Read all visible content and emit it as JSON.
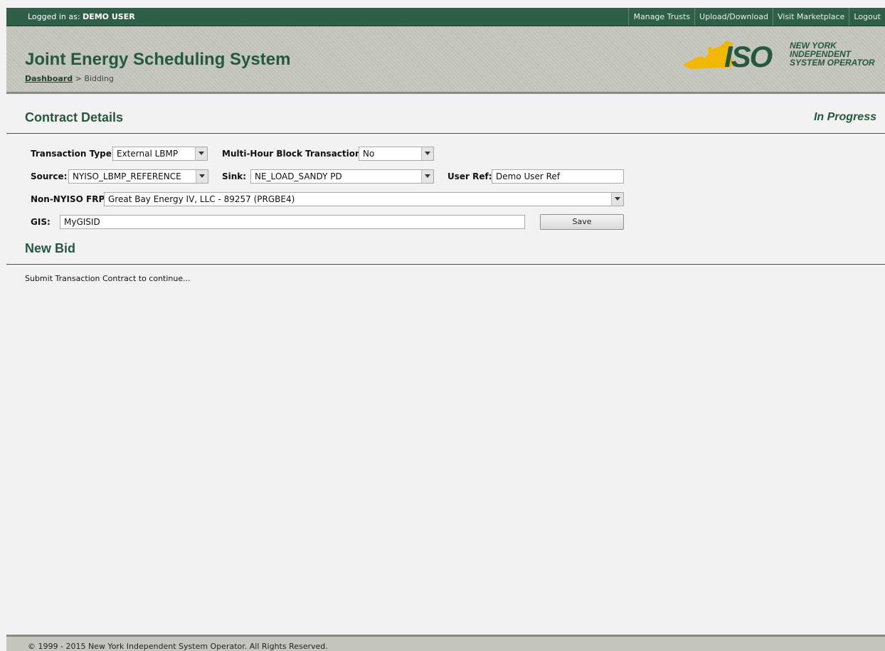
{
  "topbar": {
    "logged_prefix": "Logged in as:",
    "user": "DEMO USER",
    "nav": [
      "Manage Trusts",
      "Upload/Download",
      "Visit Marketplace",
      "Logout"
    ]
  },
  "header": {
    "title": "Joint Energy Scheduling System",
    "breadcrumb_link": "Dashboard",
    "breadcrumb_sep": " > ",
    "breadcrumb_current": "Bidding",
    "logo_mark": "ISO",
    "logo_lines": [
      "NEW YORK",
      "INDEPENDENT",
      "SYSTEM OPERATOR"
    ]
  },
  "contract": {
    "title": "Contract Details",
    "status": "In Progress",
    "transaction_type_label": "Transaction Type:",
    "transaction_type_value": "External LBMP",
    "multi_hour_label": "Multi-Hour Block Transaction:",
    "multi_hour_value": "No",
    "source_label": "Source:",
    "source_value": "NYISO_LBMP_REFERENCE",
    "sink_label": "Sink:",
    "sink_value": "NE_LOAD_SANDY PD",
    "user_ref_label": "User Ref:",
    "user_ref_value": "Demo User Ref",
    "frp_label": "Non-NYISO FRP:",
    "frp_value": "Great Bay Energy IV, LLC - 89257 (PRGBE4)",
    "gis_label": "GIS:",
    "gis_value": "MyGISID",
    "save_label": "Save"
  },
  "new_bid": {
    "title": "New Bid",
    "message": "Submit Transaction Contract to continue..."
  },
  "footer": {
    "copyright": "© 1999 - 2015 New York Independent System Operator. All Rights Reserved."
  },
  "colors": {
    "brand_green": "#26573f",
    "topbar_green": "#2f5f48",
    "logo_gold": "#f2b705"
  }
}
